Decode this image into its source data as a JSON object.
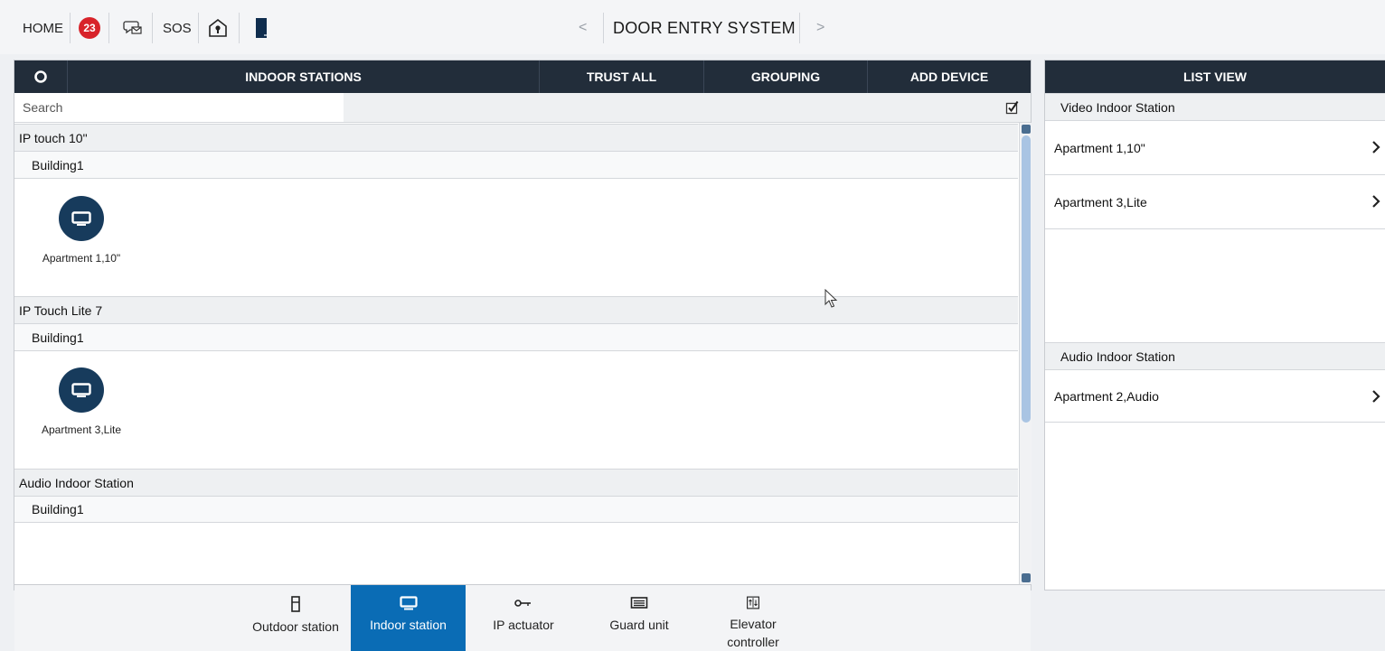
{
  "topbar": {
    "home_label": "HOME",
    "notification_count": "23",
    "sos_label": "SOS",
    "title": "DOOR ENTRY SYSTEM",
    "prev_icon": "chevron-left-icon",
    "next_icon": "chevron-right-icon"
  },
  "main_panel": {
    "header": {
      "title": "INDOOR STATIONS",
      "trust_all": "TRUST ALL",
      "grouping": "GROUPING",
      "add_device": "ADD DEVICE"
    },
    "search": {
      "placeholder": "Search"
    },
    "groups": [
      {
        "name": "IP touch 10\"",
        "building": "Building1",
        "devices": [
          {
            "label": "Apartment 1,10\""
          }
        ]
      },
      {
        "name": "IP Touch Lite 7",
        "building": "Building1",
        "devices": [
          {
            "label": "Apartment 3,Lite"
          }
        ]
      },
      {
        "name": "Audio Indoor Station",
        "building": "Building1",
        "devices": []
      }
    ]
  },
  "device_tabs": [
    {
      "label": "Outdoor station",
      "icon": "outdoor-station-icon",
      "active": false
    },
    {
      "label": "Indoor station",
      "icon": "monitor-icon",
      "active": true
    },
    {
      "label": "IP actuator",
      "icon": "key-icon",
      "active": false
    },
    {
      "label": "Guard unit",
      "icon": "keyboard-icon",
      "active": false
    },
    {
      "label": "Elevator controller",
      "icon": "elevator-icon",
      "active": false
    }
  ],
  "list_view": {
    "title": "LIST VIEW",
    "sections": [
      {
        "name": "Video Indoor Station",
        "items": [
          "Apartment 1,10\"",
          "Apartment 3,Lite"
        ]
      },
      {
        "name": "Audio Indoor Station",
        "items": [
          "Apartment 2,Audio"
        ]
      }
    ]
  },
  "colors": {
    "header_bg": "#222d3a",
    "accent_blue": "#0a6cb5",
    "device_circle": "#173b5c",
    "badge_red": "#d8232a"
  }
}
